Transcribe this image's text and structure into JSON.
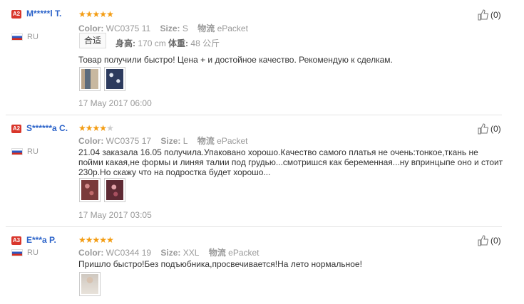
{
  "reviews": [
    {
      "badge": "A2",
      "user": "M*****l T.",
      "country": "RU",
      "stars": 5,
      "color_label": "Color:",
      "color_value": "WC0375 11",
      "size_label": "Size:",
      "size_value": "S",
      "ship_label": "物流",
      "ship_value": "ePacket",
      "fit_tag": "合适",
      "height_label": "身高:",
      "height_value": "170 cm",
      "weight_label": "体重:",
      "weight_value": "48 公斤",
      "text": "Товар получили быстро! Цена + и достойное качество. Рекомендую к сделкам.",
      "date": "17 May 2017 06:00",
      "helpful": "(0)"
    },
    {
      "badge": "A2",
      "user": "S******a C.",
      "country": "RU",
      "stars": 4,
      "color_label": "Color:",
      "color_value": "WC0375 17",
      "size_label": "Size:",
      "size_value": "L",
      "ship_label": "物流",
      "ship_value": "ePacket",
      "text": "21.04 заказала 16.05 получила.Упаковано хорошо.Качество самого платья не очень:тонкое,ткань не пойми какая,не формы и линяя талии под грудью...смотришся как беременная...ну впринцыпе оно и стоит 230р.Но скажу что на подростка будет хорошо...",
      "date": "17 May 2017 03:05",
      "helpful": "(0)"
    },
    {
      "badge": "A3",
      "user": "E***a P.",
      "country": "RU",
      "stars": 5,
      "color_label": "Color:",
      "color_value": "WC0344 19",
      "size_label": "Size:",
      "size_value": "XXL",
      "ship_label": "物流",
      "ship_value": "ePacket",
      "text": "Пришло быстро!Без подъюбника,просвечивается!На лето нормальное!",
      "helpful": "(0)"
    }
  ],
  "colors": {
    "star_on": "#f39c12",
    "star_off": "#cccccc",
    "username": "#2a62c9",
    "badge": "#d9362b"
  }
}
